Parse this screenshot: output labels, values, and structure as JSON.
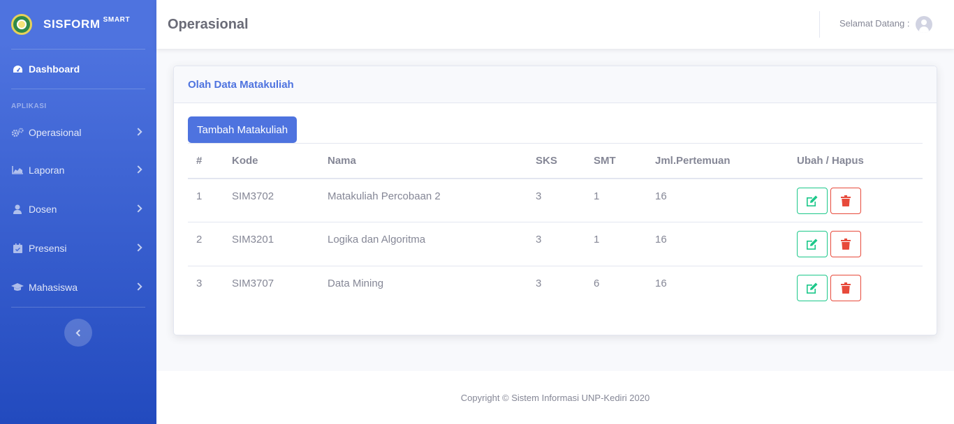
{
  "sidebar": {
    "brand": "SISFORM",
    "brand_sup": "SMART",
    "dashboard": "Dashboard",
    "heading": "APLIKASI",
    "items": [
      {
        "label": "Operasional",
        "icon": "cogs-icon"
      },
      {
        "label": "Laporan",
        "icon": "chart-area-icon"
      },
      {
        "label": "Dosen",
        "icon": "user-icon"
      },
      {
        "label": "Presensi",
        "icon": "calendar-check-icon"
      },
      {
        "label": "Mahasiswa",
        "icon": "graduation-cap-icon"
      }
    ]
  },
  "topbar": {
    "title": "Operasional",
    "welcome": "Selamat Datang :"
  },
  "card": {
    "title": "Olah Data Matakuliah",
    "add_button": "Tambah Matakuliah"
  },
  "table": {
    "headers": [
      "#",
      "Kode",
      "Nama",
      "SKS",
      "SMT",
      "Jml.Pertemuan",
      "Ubah / Hapus"
    ],
    "rows": [
      {
        "no": "1",
        "kode": "SIM3702",
        "nama": "Matakuliah Percobaan 2",
        "sks": "3",
        "smt": "1",
        "pertemuan": "16"
      },
      {
        "no": "2",
        "kode": "SIM3201",
        "nama": "Logika dan Algoritma",
        "sks": "3",
        "smt": "1",
        "pertemuan": "16"
      },
      {
        "no": "3",
        "kode": "SIM3707",
        "nama": "Data Mining",
        "sks": "3",
        "smt": "6",
        "pertemuan": "16"
      }
    ]
  },
  "footer": {
    "text": "Copyright © Sistem Informasi UNP-Kediri 2020"
  },
  "colors": {
    "primary": "#4e73df",
    "success": "#1cc88a",
    "danger": "#e74a3b"
  }
}
